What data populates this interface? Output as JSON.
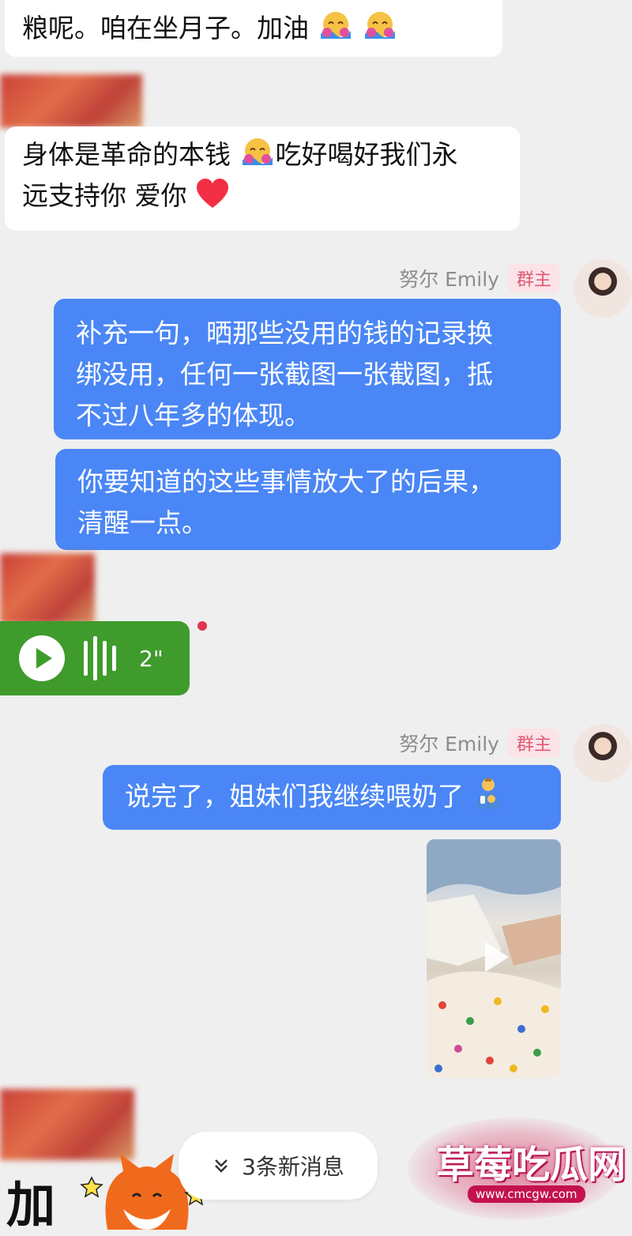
{
  "messages": {
    "m1": {
      "text": "粮呢。咱在坐月子。加油"
    },
    "m2": {
      "line1": "身体是革命的本钱",
      "line1b": "吃好喝好我们永",
      "line2": "远支持你 爱你"
    },
    "sender1": {
      "name": "努尔 Emily",
      "badge": "群主"
    },
    "m3": {
      "line1": "补充一句，晒那些没用的钱的记录换",
      "line2": "绑没用，任何一张截图一张截图，抵",
      "line3": "不过八年多的体现。"
    },
    "m4": {
      "line1": "你要知道的这些事情放大了的后果，",
      "line2": "清醒一点。"
    },
    "voice": {
      "duration": "2\""
    },
    "sender2": {
      "name": "努尔 Emily",
      "badge": "群主"
    },
    "m5": {
      "text": "说完了，姐妹们我继续喂奶了"
    }
  },
  "new_messages_pill": {
    "label": "3条新消息"
  },
  "watermark": {
    "title": "草莓吃瓜网",
    "url": "www.cmcgw.com"
  },
  "sticker": {
    "text": "加"
  },
  "icons": {
    "hug_emoji": "hugging-face-icon",
    "heart_emoji": "red-heart-icon",
    "feeding_emoji": "person-feeding-baby-icon",
    "play": "play-icon",
    "chevron": "double-chevron-down-icon"
  },
  "colors": {
    "background": "#efefef",
    "outgoing_bubble": "#4a86f5",
    "voice_bubble": "#3f9b2c",
    "badge_text": "#e05a72",
    "unread_dot": "#e0344f"
  }
}
